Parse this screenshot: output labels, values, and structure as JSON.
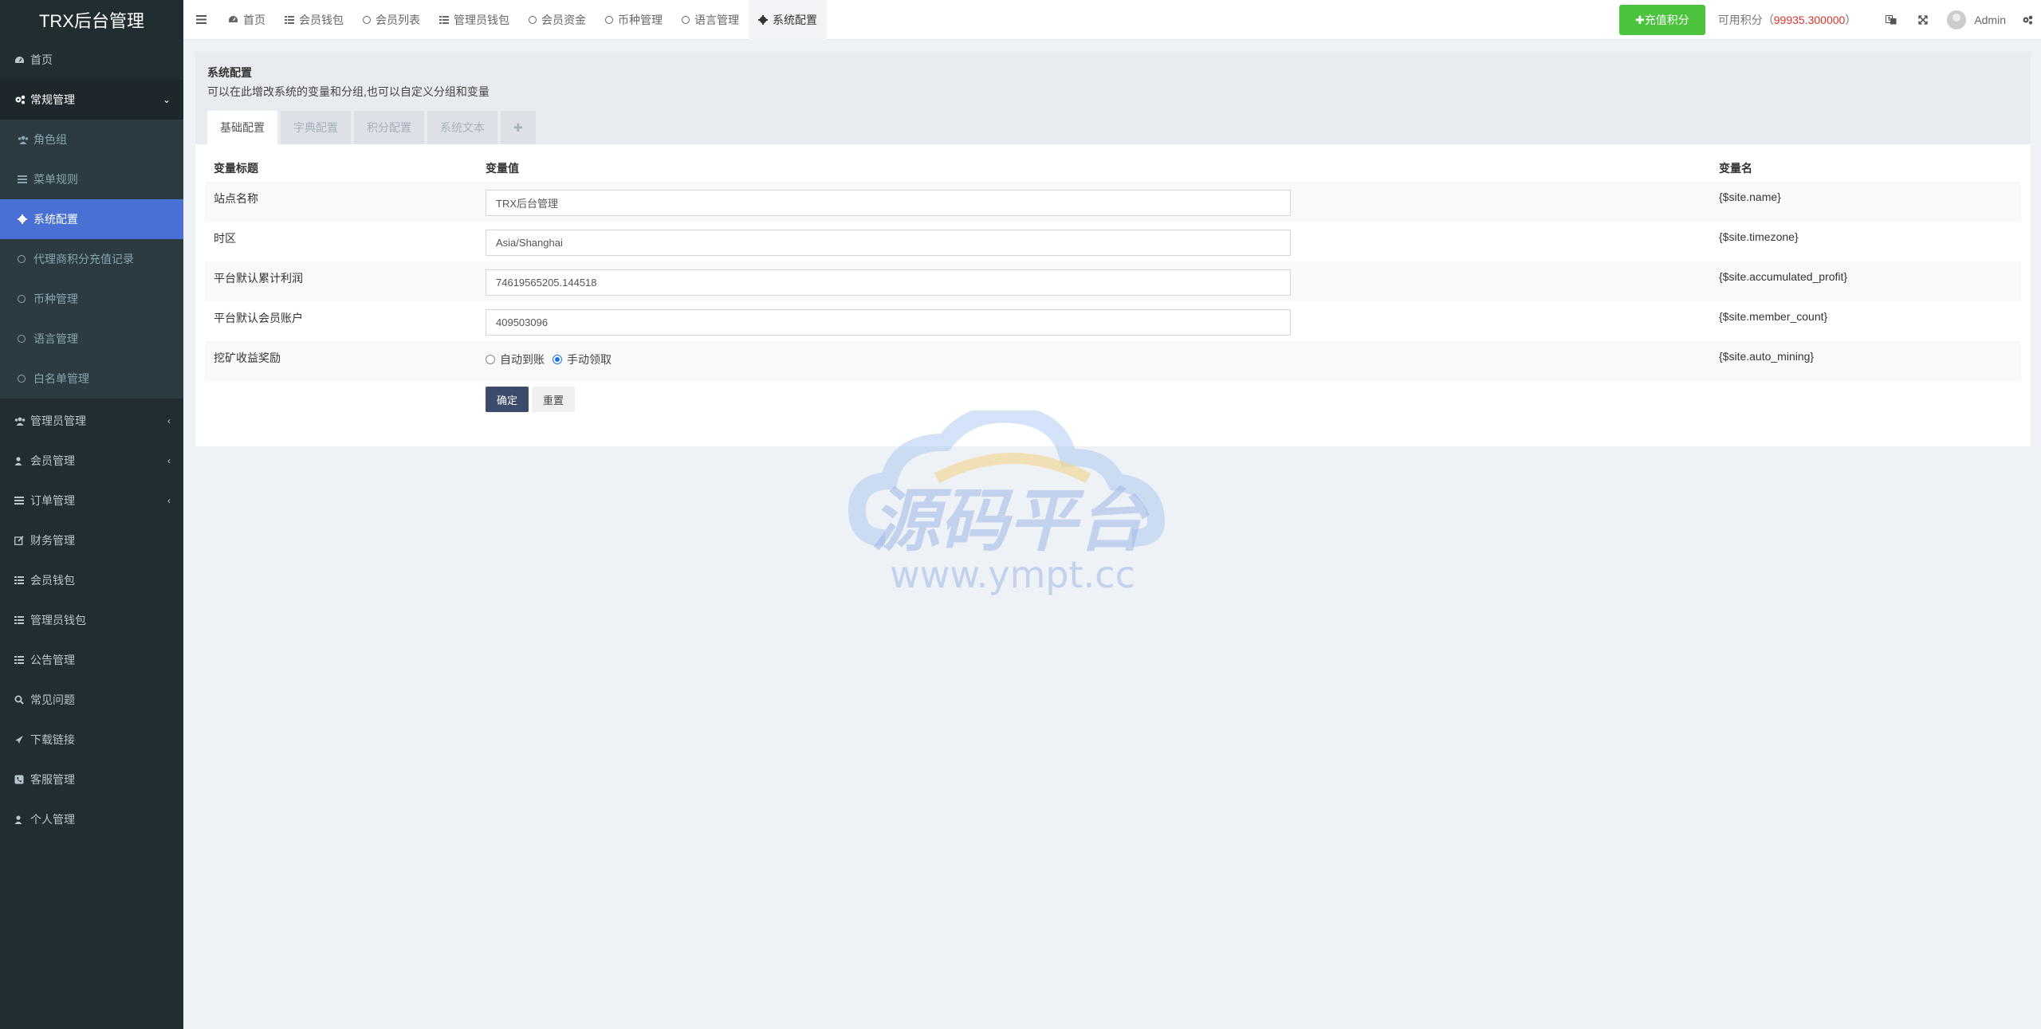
{
  "app": {
    "title": "TRX后台管理"
  },
  "sidebar": {
    "items": [
      {
        "label": "首页",
        "icon": "dashboard-icon"
      },
      {
        "label": "常规管理",
        "icon": "cogs-icon",
        "open": true
      },
      {
        "label": "管理员管理",
        "icon": "users-icon"
      },
      {
        "label": "会员管理",
        "icon": "user-icon"
      },
      {
        "label": "订单管理",
        "icon": "list-icon"
      },
      {
        "label": "财务管理",
        "icon": "edit-icon"
      },
      {
        "label": "会员钱包",
        "icon": "list-alt-icon"
      },
      {
        "label": "管理员钱包",
        "icon": "list-alt-icon"
      },
      {
        "label": "公告管理",
        "icon": "list-alt-icon"
      },
      {
        "label": "常见问题",
        "icon": "search-icon"
      },
      {
        "label": "下载链接",
        "icon": "plane-icon"
      },
      {
        "label": "客服管理",
        "icon": "phone-icon"
      },
      {
        "label": "个人管理",
        "icon": "user-icon"
      }
    ],
    "submenu": [
      {
        "label": "角色组",
        "icon": "users-icon"
      },
      {
        "label": "菜单规则",
        "icon": "bars-icon"
      },
      {
        "label": "系统配置",
        "icon": "cog-icon",
        "active": true
      },
      {
        "label": "代理商积分充值记录",
        "icon": "circle-icon"
      },
      {
        "label": "币种管理",
        "icon": "circle-icon"
      },
      {
        "label": "语言管理",
        "icon": "circle-icon"
      },
      {
        "label": "白名单管理",
        "icon": "circle-icon"
      }
    ]
  },
  "topbar": {
    "tabs": [
      {
        "label": "首页",
        "icon": "dashboard-icon"
      },
      {
        "label": "会员钱包",
        "icon": "list-alt-icon"
      },
      {
        "label": "会员列表",
        "icon": "circle-icon"
      },
      {
        "label": "管理员钱包",
        "icon": "list-alt-icon"
      },
      {
        "label": "会员资金",
        "icon": "circle-icon"
      },
      {
        "label": "币种管理",
        "icon": "circle-icon"
      },
      {
        "label": "语言管理",
        "icon": "circle-icon"
      },
      {
        "label": "系统配置",
        "icon": "cog-icon",
        "active": true
      }
    ],
    "recharge_button": "✚充值积分",
    "credit_label": "可用积分（",
    "credit_value": "99935.300000",
    "credit_suffix": "）",
    "user_name": "Admin"
  },
  "page": {
    "title": "系统配置",
    "description": "可以在此增改系统的变量和分组,也可以自定义分组和变量",
    "tabs": [
      "基础配置",
      "字典配置",
      "积分配置",
      "系统文本",
      "✚"
    ]
  },
  "table": {
    "headers": [
      "变量标题",
      "变量值",
      "变量名"
    ],
    "rows": [
      {
        "title": "站点名称",
        "value": "TRX后台管理",
        "name": "{$site.name}"
      },
      {
        "title": "时区",
        "value": "Asia/Shanghai",
        "name": "{$site.timezone}"
      },
      {
        "title": "平台默认累计利润",
        "value": "74619565205.144518",
        "name": "{$site.accumulated_profit}"
      },
      {
        "title": "平台默认会员账户",
        "value": "409503096",
        "name": "{$site.member_count}"
      },
      {
        "title": "挖矿收益奖励",
        "name": "{$site.auto_mining}",
        "options": [
          "自动到账",
          "手动领取"
        ],
        "selected": "手动领取"
      }
    ],
    "submit_label": "确定",
    "reset_label": "重置"
  },
  "watermark": {
    "brand": "源码平台",
    "url": "www.ympt.cc"
  },
  "colors": {
    "sidebar_bg": "#222d32",
    "active_blue": "#4a6fd5",
    "green": "#4cc33c",
    "credit_red": "#d9342b",
    "primary_btn": "#3c4a6b"
  }
}
